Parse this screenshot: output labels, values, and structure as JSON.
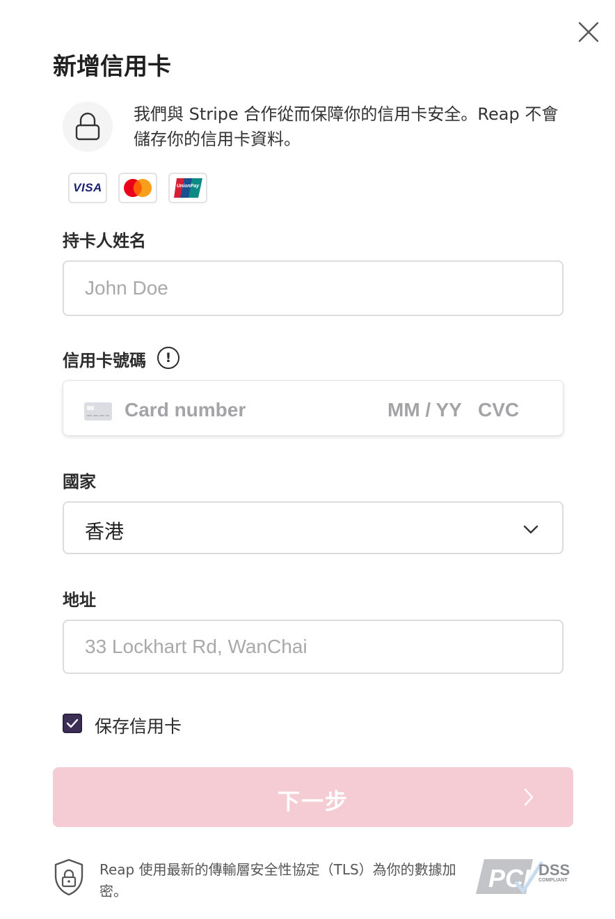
{
  "dialog": {
    "title": "新增信用卡",
    "security_notice": "我們與 Stripe 合作從而保障你的信用卡安全。Reap 不會儲存你的信用卡資料。"
  },
  "card_brands": {
    "visa_label": "VISA",
    "unionpay_label": "UnionPay",
    "icons": [
      "visa-logo",
      "mastercard-logo",
      "unionpay-logo"
    ]
  },
  "form": {
    "cardholder": {
      "label": "持卡人姓名",
      "placeholder": "John Doe",
      "value": ""
    },
    "card_number": {
      "label": "信用卡號碼",
      "info_glyph": "!",
      "number_placeholder": "Card number",
      "expiry_placeholder": "MM / YY",
      "cvc_placeholder": "CVC"
    },
    "country": {
      "label": "國家",
      "value": "香港"
    },
    "address": {
      "label": "地址",
      "placeholder": "33 Lockhart Rd, WanChai",
      "value": ""
    },
    "save_card": {
      "label": "保存信用卡",
      "checked": true
    }
  },
  "actions": {
    "next_label": "下一步"
  },
  "footer": {
    "tls_text": "Reap 使用最新的傳輸層安全性協定（TLS）為你的數據加密。",
    "badge_pci": "PCI",
    "badge_dss": "DSS",
    "badge_compliant": "COMPLIANT"
  },
  "colors": {
    "checkbox": "#3d2e55",
    "next_button_disabled": "#f5ccd3",
    "border": "#dcdcdf",
    "placeholder": "#a9a9a9"
  }
}
